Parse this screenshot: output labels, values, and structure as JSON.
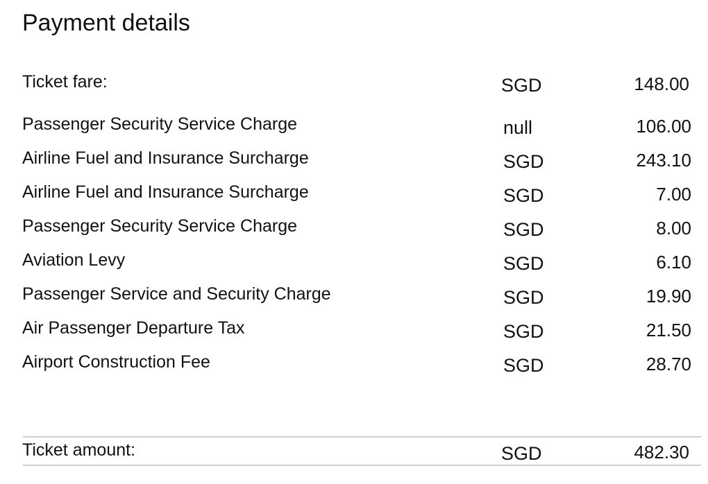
{
  "title": "Payment details",
  "ticket_fare": {
    "label": "Ticket fare:",
    "currency": "SGD",
    "amount": "148.00"
  },
  "charges": [
    {
      "label": "Passenger Security Service Charge",
      "currency": "null",
      "amount": "106.00"
    },
    {
      "label": "Airline Fuel and Insurance Surcharge",
      "currency": "SGD",
      "amount": "243.10"
    },
    {
      "label": "Airline Fuel and Insurance Surcharge",
      "currency": "SGD",
      "amount": "7.00"
    },
    {
      "label": "Passenger Security Service Charge",
      "currency": "SGD",
      "amount": "8.00"
    },
    {
      "label": "Aviation Levy",
      "currency": "SGD",
      "amount": "6.10"
    },
    {
      "label": "Passenger Service and Security Charge",
      "currency": "SGD",
      "amount": "19.90"
    },
    {
      "label": "Air Passenger Departure Tax",
      "currency": "SGD",
      "amount": "21.50"
    },
    {
      "label": "Airport Construction Fee",
      "currency": "SGD",
      "amount": "28.70"
    }
  ],
  "total": {
    "label": "Ticket amount:",
    "currency": "SGD",
    "amount": "482.30"
  }
}
